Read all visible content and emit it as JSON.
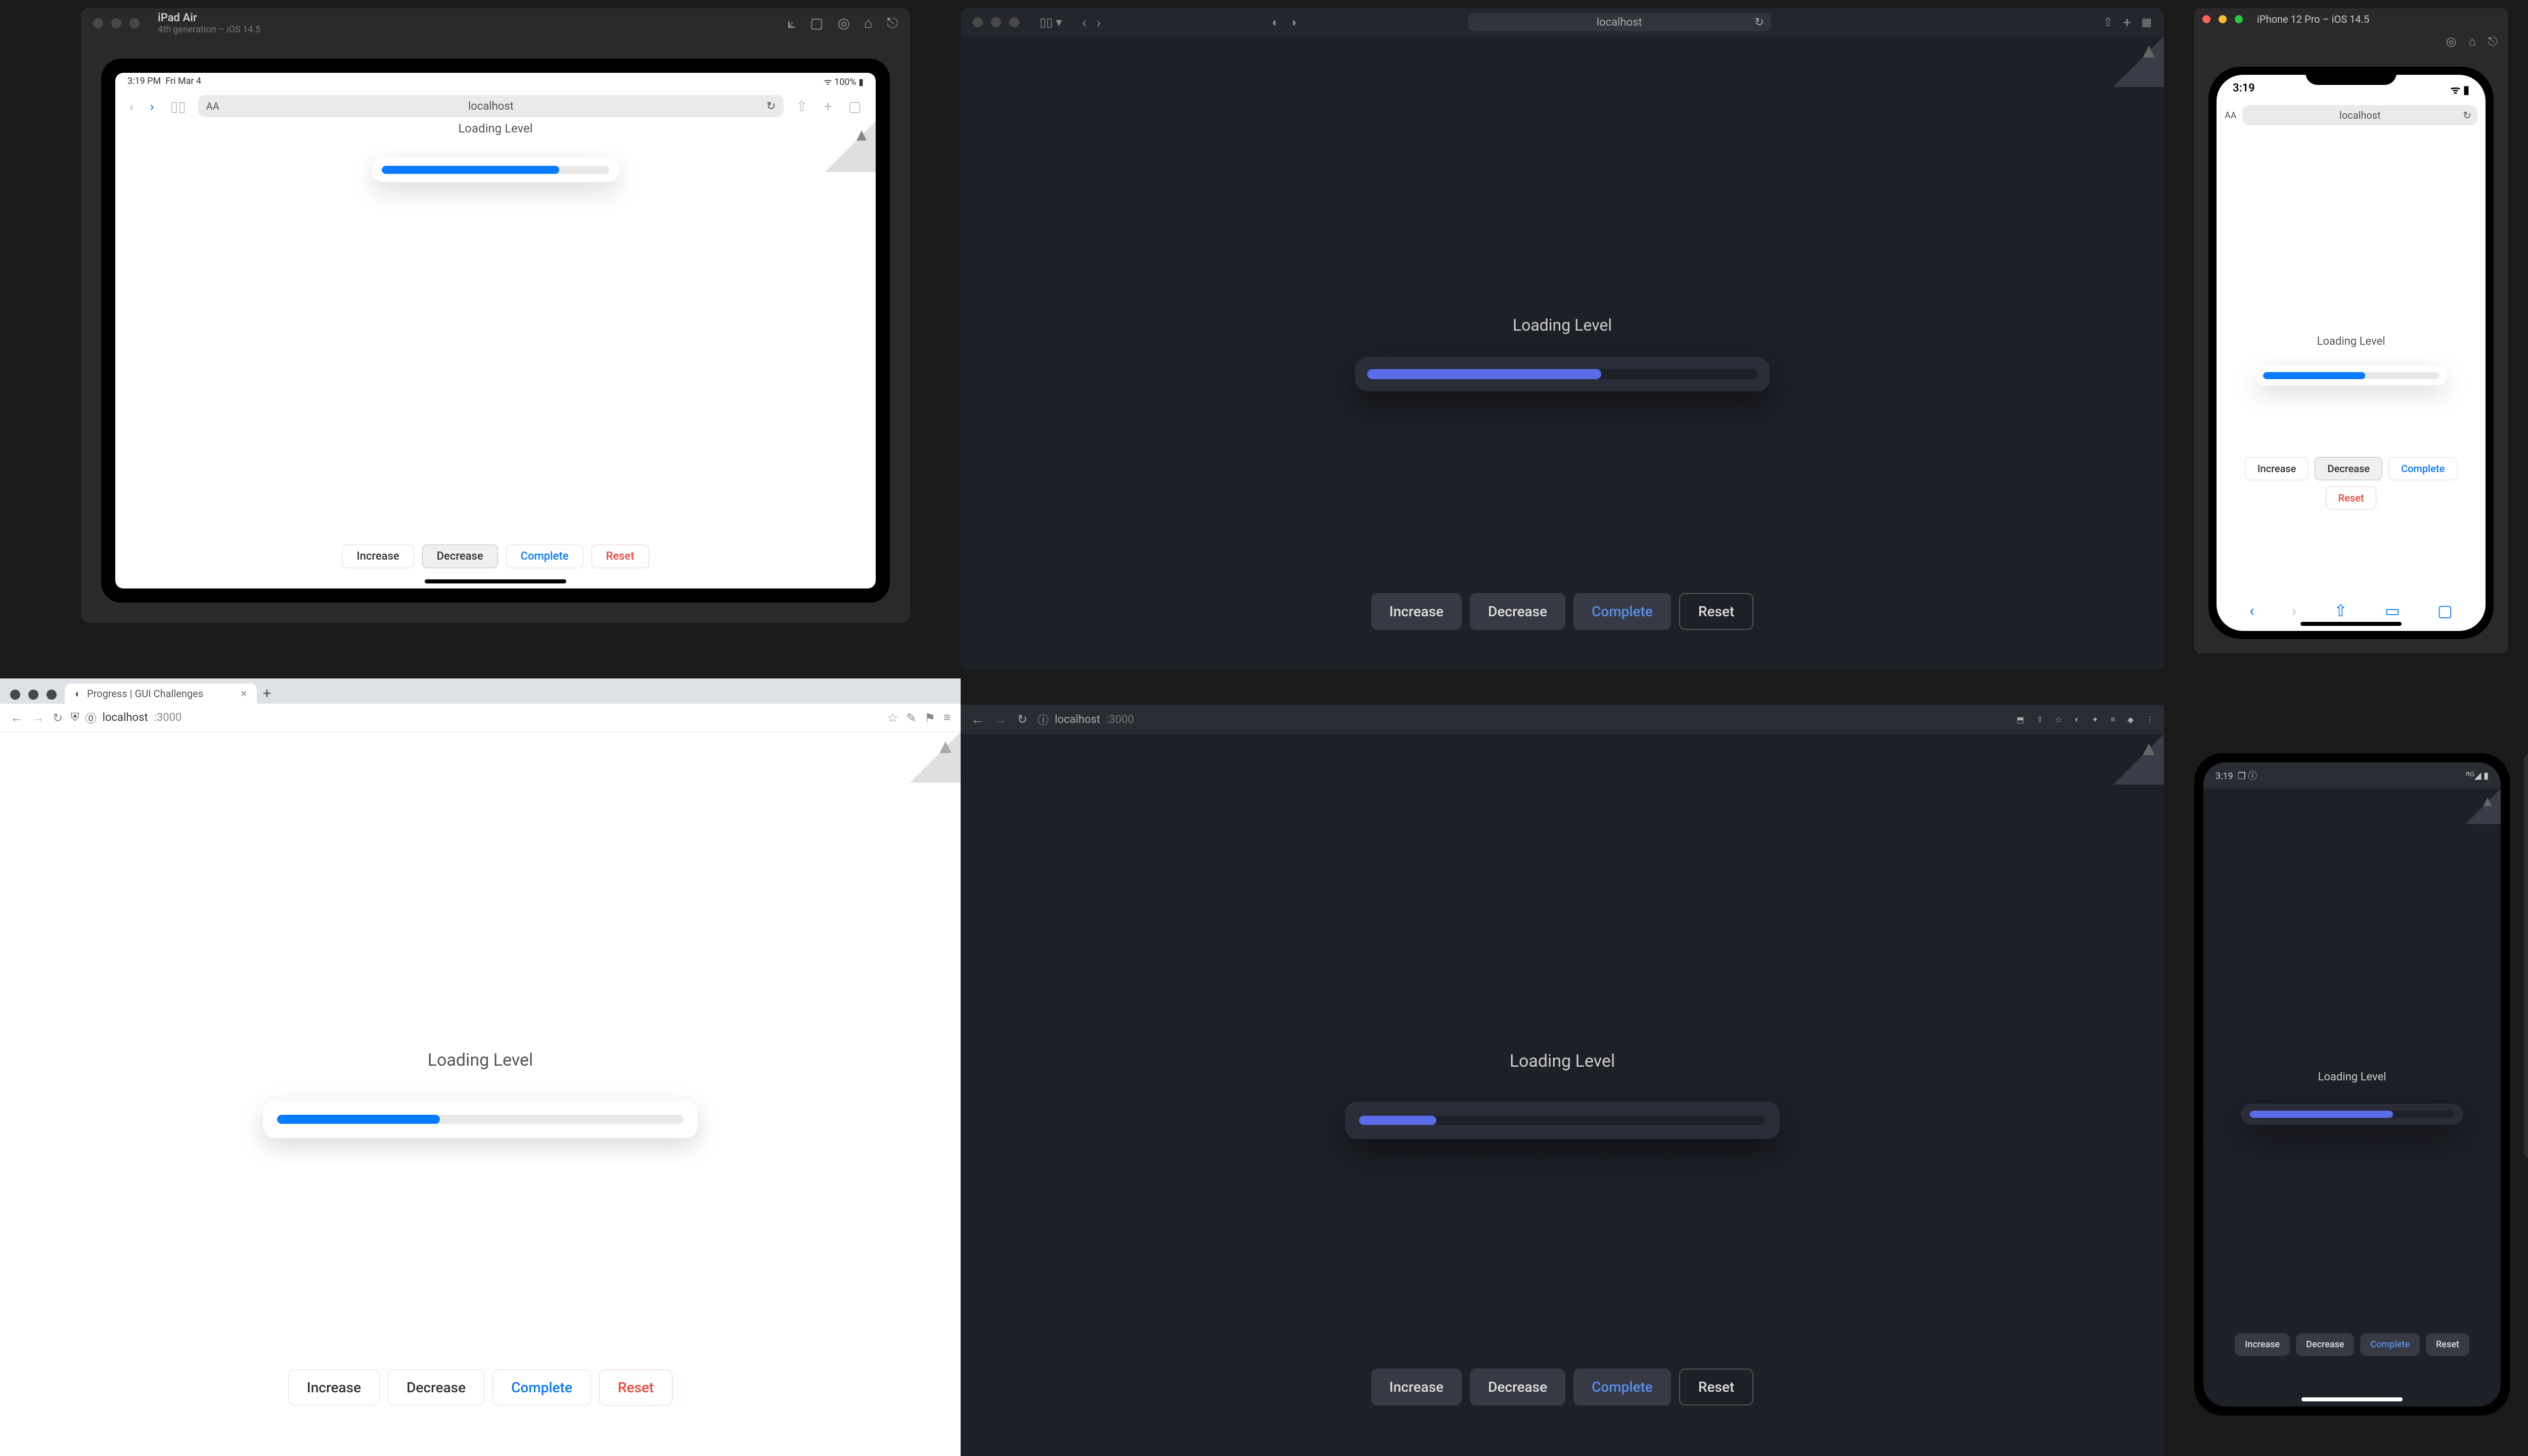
{
  "app": {
    "loading_label": "Loading Level",
    "url_host": "localhost",
    "url_port": ":3000",
    "buttons": {
      "increase": "Increase",
      "decrease": "Decrease",
      "complete": "Complete",
      "reset": "Reset"
    }
  },
  "ipad": {
    "title": "iPad Air",
    "subtitle": "4th generation – iOS 14.5",
    "status_time": "3:19 PM",
    "status_date": "Fri Mar 4",
    "status_right": "100%",
    "progress_pct": 78
  },
  "safari_main": {
    "progress_pct": 60
  },
  "chrome_light": {
    "tab_title": "Progress | GUI Challenges",
    "progress_pct": 40
  },
  "chrome_dark": {
    "progress_pct": 19
  },
  "iphone": {
    "title": "iPhone 12 Pro – iOS 14.5",
    "status_time": "3:19",
    "progress_pct": 58
  },
  "android": {
    "status_time": "3:19",
    "progress_pct": 70
  }
}
